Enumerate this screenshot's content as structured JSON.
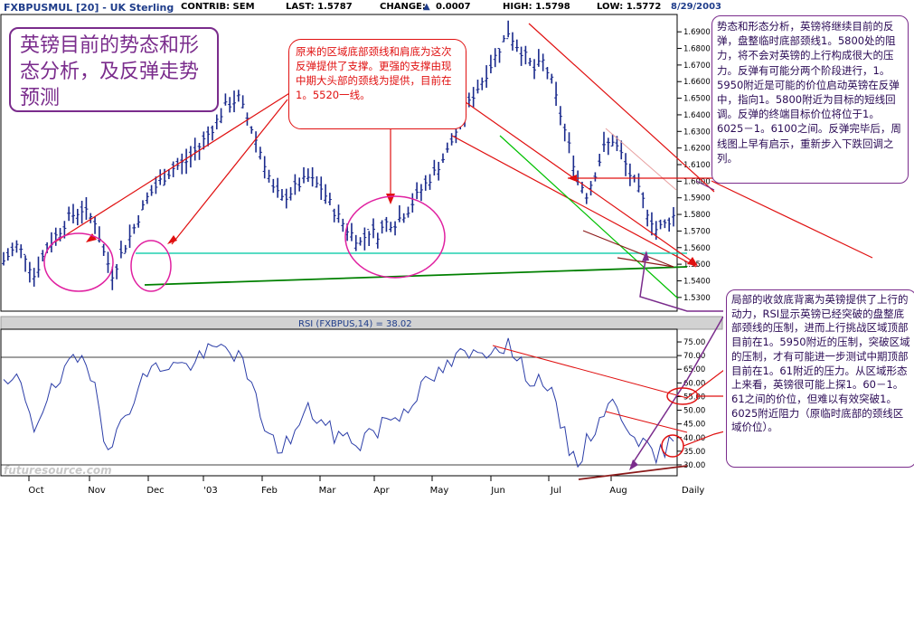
{
  "header": {
    "symbol": "FXBPUSMUL [20] - UK Sterling",
    "contrib": "CONTRIB: SEM",
    "last": "LAST: 1.5787",
    "change_label": "CHANGE:",
    "change_value": "0.0007",
    "high": "HIGH: 1.5798",
    "low": "LOW: 1.5772",
    "date": "8/29/2003"
  },
  "notes": {
    "title": "英镑目前的势态和形态分析，及反弹走势预测",
    "center": "原来的区域底部颈线和肩底为这次反弹提供了支撑。更强的支撑由现中期大头部的颈线为提供，目前在1。5520一线。",
    "right_top": "势态和形态分析，英镑将继续目前的反弹，盘整临时底部颈线1。5800处的阻力，将不会对英镑的上行构成很大的压力。反弹有可能分两个阶段进行，1。5950附近是可能的价位启动英镑在反弹中，指向1。5800附近为目标的短线回调。反弹的终端目标价位将位于1。6025－1。6100之间。反弹完毕后，周线图上早有启示，重新步入下跌回调之列。",
    "right_bottom": "局部的收敛底背离为英镑提供了上行的动力，RSI显示英镑已经突破的盘整底部颈线的压制，进而上行挑战区域顶部目前在1。5950附近的压制，突破区域的压制，才有可能进一步测试中期顶部目前在1。61附近的压力。从区域形态上来看，英镑很可能上探1。60－1。61之间的价位，但难以有效突破1。6025附近阻力（原临时底部的颈线区域价位）。"
  },
  "rsi_label": "RSI (FXBPUS,14) = 38.02",
  "watermark": "futuresource.com",
  "period_label": "Daily",
  "colors": {
    "bars": "#1a2a8c",
    "rsi": "#2c3ea8",
    "annot_red": "#e01010",
    "annot_purple": "#7a2c8c",
    "support_green": "#00a000",
    "cyan": "#20d0b0"
  },
  "chart_data": [
    {
      "type": "ohlc",
      "title": "FXBPUSMUL [20] - UK Sterling",
      "categories": [
        "Oct",
        "Nov",
        "Dec",
        "'03",
        "Feb",
        "Mar",
        "Apr",
        "May",
        "Jun",
        "Jul",
        "Aug"
      ],
      "x_tick_labels": [
        "Oct",
        "Nov",
        "Dec",
        "'03",
        "Feb",
        "Mar",
        "Apr",
        "May",
        "Jun",
        "Jul",
        "Aug",
        "Daily"
      ],
      "y_tick_labels": [
        "1.5300",
        "1.5400",
        "1.5500",
        "1.5600",
        "1.5700",
        "1.5800",
        "1.5900",
        "1.6000",
        "1.6100",
        "1.6200",
        "1.6300",
        "1.6400",
        "1.6500",
        "1.6600",
        "1.6700",
        "1.6800",
        "1.6900"
      ],
      "ylim": [
        1.525,
        1.695
      ],
      "close_path": [
        [
          0,
          1.552
        ],
        [
          3,
          1.561
        ],
        [
          5,
          1.555
        ],
        [
          7,
          1.543
        ],
        [
          10,
          1.56
        ],
        [
          12,
          1.567
        ],
        [
          15,
          1.578
        ],
        [
          18,
          1.583
        ],
        [
          21,
          1.576
        ],
        [
          23,
          1.557
        ],
        [
          25,
          1.544
        ],
        [
          27,
          1.556
        ],
        [
          30,
          1.572
        ],
        [
          33,
          1.59
        ],
        [
          36,
          1.6
        ],
        [
          39,
          1.608
        ],
        [
          42,
          1.612
        ],
        [
          45,
          1.621
        ],
        [
          48,
          1.632
        ],
        [
          51,
          1.645
        ],
        [
          54,
          1.65
        ],
        [
          57,
          1.632
        ],
        [
          60,
          1.611
        ],
        [
          62,
          1.595
        ],
        [
          64,
          1.589
        ],
        [
          67,
          1.596
        ],
        [
          70,
          1.602
        ],
        [
          73,
          1.596
        ],
        [
          76,
          1.582
        ],
        [
          79,
          1.571
        ],
        [
          82,
          1.563
        ],
        [
          84,
          1.57
        ],
        [
          86,
          1.568
        ],
        [
          88,
          1.575
        ],
        [
          90,
          1.575
        ],
        [
          93,
          1.583
        ],
        [
          96,
          1.595
        ],
        [
          99,
          1.605
        ],
        [
          102,
          1.618
        ],
        [
          105,
          1.636
        ],
        [
          108,
          1.652
        ],
        [
          111,
          1.665
        ],
        [
          114,
          1.68
        ],
        [
          116,
          1.69
        ],
        [
          118,
          1.682
        ],
        [
          120,
          1.675
        ],
        [
          122,
          1.667
        ],
        [
          124,
          1.672
        ],
        [
          126,
          1.66
        ],
        [
          128,
          1.64
        ],
        [
          130,
          1.621
        ],
        [
          132,
          1.602
        ],
        [
          134,
          1.592
        ],
        [
          136,
          1.605
        ],
        [
          138,
          1.62
        ],
        [
          140,
          1.625
        ],
        [
          142,
          1.616
        ],
        [
          144,
          1.604
        ],
        [
          146,
          1.594
        ],
        [
          148,
          1.582
        ],
        [
          150,
          1.571
        ],
        [
          152,
          1.574
        ],
        [
          154,
          1.579
        ]
      ],
      "rsi": {
        "label": "RSI (FXBPUS,14) = 38.02",
        "y_tick_labels": [
          "30.00",
          "35.00",
          "40.00",
          "45.00",
          "50.00",
          "55.00",
          "60.00",
          "65.00",
          "70.00",
          "75.00"
        ],
        "ylim": [
          28,
          77
        ],
        "last": 38.02,
        "values": [
          [
            0,
            58
          ],
          [
            3,
            61
          ],
          [
            5,
            55
          ],
          [
            7,
            44
          ],
          [
            10,
            55
          ],
          [
            12,
            58
          ],
          [
            15,
            66
          ],
          [
            18,
            69
          ],
          [
            21,
            62
          ],
          [
            23,
            42
          ],
          [
            25,
            35
          ],
          [
            27,
            46
          ],
          [
            30,
            55
          ],
          [
            33,
            64
          ],
          [
            36,
            66
          ],
          [
            39,
            67
          ],
          [
            42,
            66
          ],
          [
            45,
            69
          ],
          [
            48,
            72
          ],
          [
            51,
            73
          ],
          [
            54,
            70
          ],
          [
            57,
            58
          ],
          [
            60,
            45
          ],
          [
            62,
            38
          ],
          [
            64,
            36
          ],
          [
            67,
            42
          ],
          [
            70,
            50
          ],
          [
            73,
            46
          ],
          [
            76,
            41
          ],
          [
            79,
            40
          ],
          [
            82,
            38
          ],
          [
            84,
            43
          ],
          [
            86,
            42
          ],
          [
            88,
            48
          ],
          [
            90,
            47
          ],
          [
            93,
            52
          ],
          [
            96,
            58
          ],
          [
            99,
            62
          ],
          [
            102,
            66
          ],
          [
            105,
            70
          ],
          [
            108,
            70
          ],
          [
            111,
            72
          ],
          [
            114,
            74
          ],
          [
            116,
            74
          ],
          [
            118,
            68
          ],
          [
            120,
            64
          ],
          [
            122,
            60
          ],
          [
            124,
            62
          ],
          [
            126,
            55
          ],
          [
            128,
            45
          ],
          [
            130,
            36
          ],
          [
            132,
            31
          ],
          [
            134,
            38
          ],
          [
            136,
            44
          ],
          [
            138,
            50
          ],
          [
            140,
            52
          ],
          [
            142,
            48
          ],
          [
            144,
            44
          ],
          [
            146,
            40
          ],
          [
            148,
            35
          ],
          [
            150,
            32
          ],
          [
            152,
            36
          ],
          [
            154,
            38
          ]
        ]
      }
    }
  ]
}
